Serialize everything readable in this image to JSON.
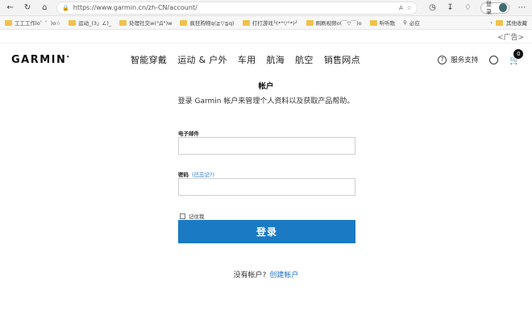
{
  "browser": {
    "url": "https://www.garmin.cn/zh-CN/account/",
    "signin_label": "登录"
  },
  "bookmarks": [
    {
      "label": "工工工作lo゜゜)o☆"
    },
    {
      "label": "运动_(3」∠)_"
    },
    {
      "label": "处理社交w(°Д°)w"
    },
    {
      "label": "疯狂购物q(≧▽≦q)"
    },
    {
      "label": "打打游戏╰(*°▽°*)╯"
    },
    {
      "label": "刷刷视频o(￣▽￣)o"
    },
    {
      "label": "听听歌"
    },
    {
      "label": "必应"
    }
  ],
  "bookmarks_more": "其他收藏",
  "ad_label": "<广告>",
  "header": {
    "logo": "GARMIN",
    "nav": [
      "智能穿戴",
      "运动 & 户外",
      "车用",
      "航海",
      "航空",
      "销售网点"
    ],
    "support": "服务支持",
    "cart_count": "0"
  },
  "account": {
    "title": "帐户",
    "subtitle": "登录 Garmin 帐户来管理个人资料以及获取产品帮助。",
    "email_label": "电子邮件",
    "password_label": "密码",
    "forgot_label": "(已忘记?)",
    "remember_label": "记住我",
    "login_button": "登录",
    "no_account": "没有帐户?",
    "create_account": "创建帐户"
  }
}
